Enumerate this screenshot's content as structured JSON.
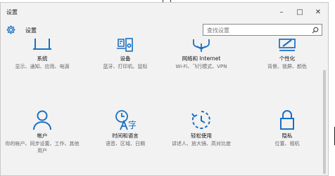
{
  "window": {
    "title": "设置",
    "minimize_glyph": "–",
    "maximize_glyph": "□",
    "close_glyph": "✕"
  },
  "header": {
    "label": "设置",
    "search_placeholder": "查找设置"
  },
  "tiles": [
    {
      "name": "系统",
      "desc": "显示、通知、应用、电源",
      "icon": "display-icon"
    },
    {
      "name": "设备",
      "desc": "蓝牙、打印机、鼠标",
      "icon": "devices-icon"
    },
    {
      "name": "网络和 Internet",
      "desc": "Wi-Fi、飞行模式、VPN",
      "icon": "network-icon"
    },
    {
      "name": "个性化",
      "desc": "背景、锁屏、颜色",
      "icon": "personalization-icon"
    },
    {
      "name": "帐户",
      "desc": "你的帐户、同步设置、工作、其他用户",
      "icon": "account-icon"
    },
    {
      "name": "时间和语言",
      "desc": "语音、区域、日期",
      "icon": "time-language-icon"
    },
    {
      "name": "轻松使用",
      "desc": "讲述人、放大镜、高对比度",
      "icon": "ease-of-access-icon"
    },
    {
      "name": "隐私",
      "desc": "位置、相机",
      "icon": "privacy-icon"
    }
  ],
  "colors": {
    "accent": "#1a6fc4",
    "background": "#f2f2f2"
  }
}
